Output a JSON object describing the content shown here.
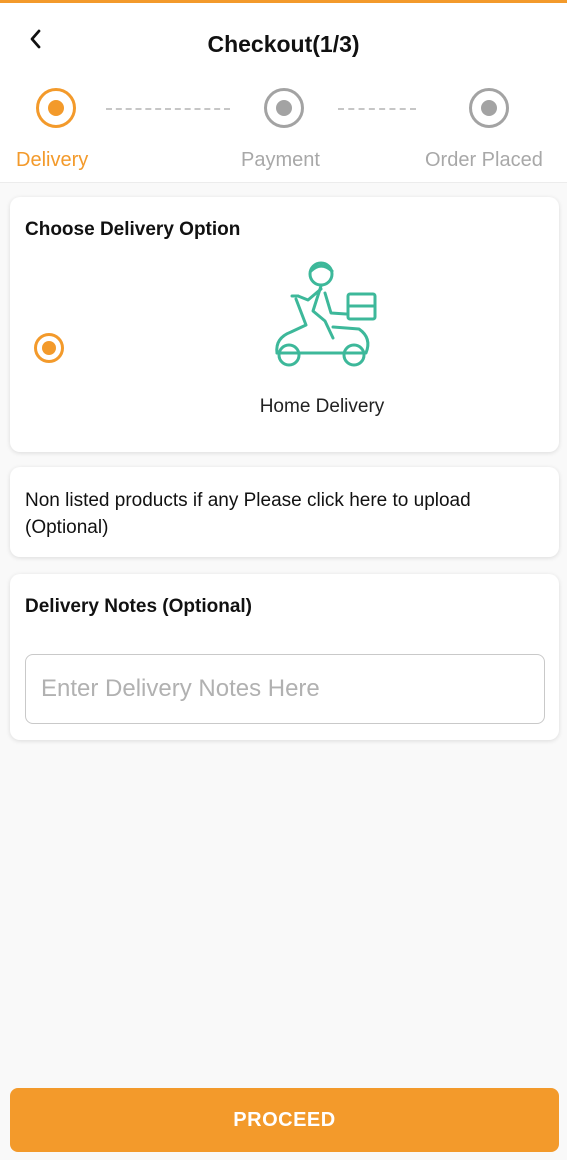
{
  "header": {
    "title": "Checkout(1/3)",
    "back_icon": "chevron-left-icon"
  },
  "stepper": {
    "steps": [
      {
        "label": "Delivery",
        "state": "active"
      },
      {
        "label": "Payment",
        "state": "inactive"
      },
      {
        "label": "Order Placed",
        "state": "inactive"
      }
    ]
  },
  "delivery_option": {
    "title": "Choose Delivery Option",
    "option_label": "Home Delivery",
    "option_icon": "scooter-delivery-icon",
    "selected": true
  },
  "upload": {
    "text": "Non listed products if any Please click here to upload (Optional)"
  },
  "notes": {
    "title": "Delivery Notes (Optional)",
    "placeholder": "Enter Delivery Notes Here",
    "value": ""
  },
  "footer": {
    "proceed_label": "PROCEED"
  },
  "colors": {
    "accent": "#f39a2b",
    "inactive": "#a3a3a3",
    "icon_teal": "#3db89a"
  }
}
